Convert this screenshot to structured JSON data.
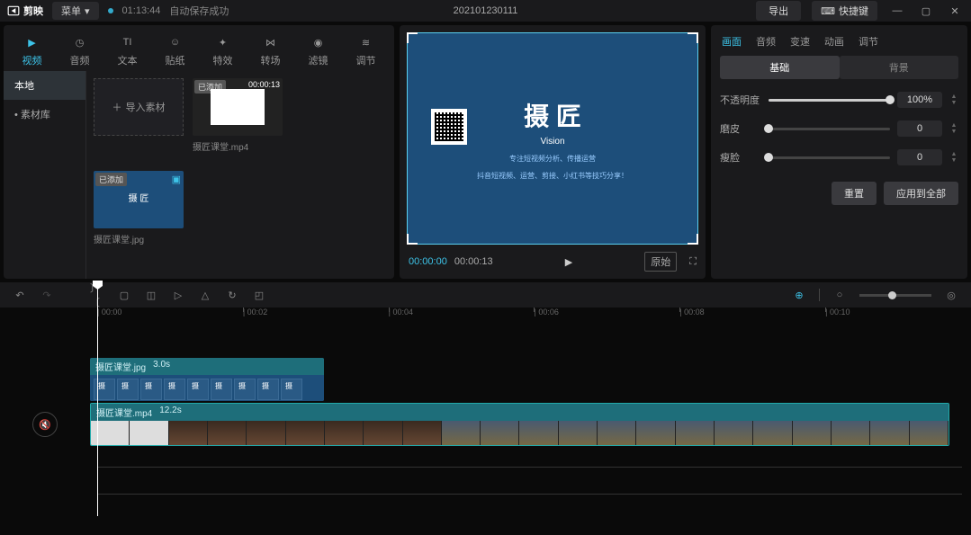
{
  "titlebar": {
    "app_name": "剪映",
    "menu": "菜单",
    "autosave_time": "01:13:44",
    "autosave_text": "自动保存成功",
    "project_name": "202101230111",
    "export": "导出",
    "shortcuts": "快捷键"
  },
  "media_tabs": [
    {
      "label": "视频",
      "active": true
    },
    {
      "label": "音频",
      "active": false
    },
    {
      "label": "文本",
      "active": false
    },
    {
      "label": "贴纸",
      "active": false
    },
    {
      "label": "特效",
      "active": false
    },
    {
      "label": "转场",
      "active": false
    },
    {
      "label": "滤镜",
      "active": false
    },
    {
      "label": "调节",
      "active": false
    }
  ],
  "media_side": [
    {
      "label": "本地",
      "active": true
    },
    {
      "label": "素材库",
      "active": false
    }
  ],
  "import_label": "导入素材",
  "media_items": [
    {
      "name": "摄匠课堂.mp4",
      "badge": "已添加",
      "duration": "00:00:13",
      "type": "video"
    },
    {
      "name": "摄匠课堂.jpg",
      "badge": "已添加",
      "type": "image"
    }
  ],
  "preview": {
    "title_main": "摄 匠",
    "title_sub": "Vision",
    "line1": "专注短视频分析、传播运营",
    "line2": "抖音短视频、运营、剪接、小红书等技巧分享！",
    "time_current": "00:00:00",
    "time_total": "00:00:13",
    "aspect": "原始"
  },
  "props": {
    "tabs": [
      "画面",
      "音频",
      "变速",
      "动画",
      "调节"
    ],
    "subtabs": [
      "基础",
      "背景"
    ],
    "opacity": {
      "label": "不透明度",
      "value": "100%",
      "pct": 100
    },
    "skin": {
      "label": "磨皮",
      "value": "0",
      "pct": 0
    },
    "face": {
      "label": "瘦脸",
      "value": "0",
      "pct": 0
    },
    "reset": "重置",
    "apply_all": "应用到全部"
  },
  "ruler": [
    "00:00",
    "00:02",
    "00:04",
    "00:06",
    "00:08",
    "00:10"
  ],
  "clips": {
    "img": {
      "name": "摄匠课堂.jpg",
      "dur": "3.0s"
    },
    "vid": {
      "name": "摄匠课堂.mp4",
      "dur": "12.2s"
    }
  }
}
